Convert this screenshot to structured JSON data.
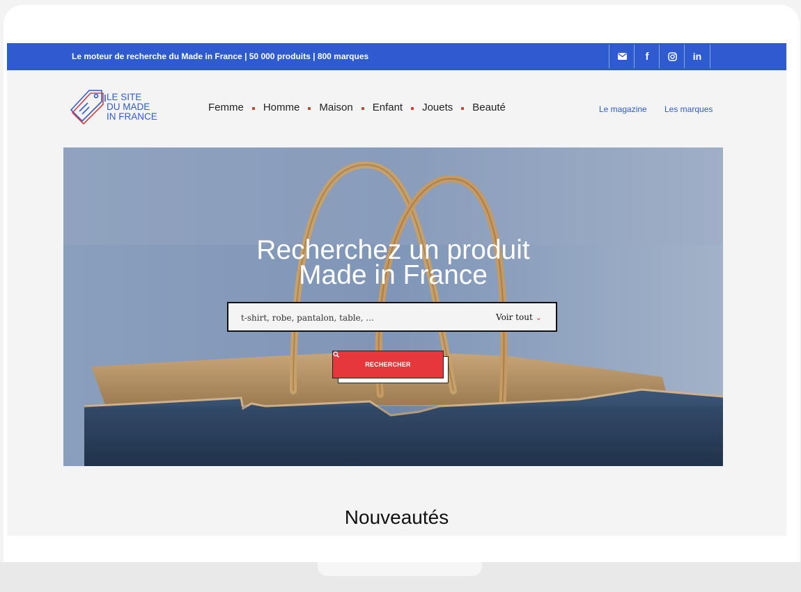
{
  "topbar": {
    "tagline": "Le moteur de recherche du Made in France | 50 000 produits | 800 marques",
    "social": [
      "email-icon",
      "facebook-icon",
      "instagram-icon",
      "linkedin-icon"
    ],
    "social_glyphs": {
      "facebook": "f",
      "linkedin": "in"
    }
  },
  "logo": {
    "text": "LE SITE\nDU MADE\nIN FRANCE"
  },
  "nav": {
    "items": [
      "Femme",
      "Homme",
      "Maison",
      "Enfant",
      "Jouets",
      "Beauté"
    ],
    "secondary": [
      "Le magazine",
      "Les marques"
    ]
  },
  "hero": {
    "title_line1": "Recherchez un produit",
    "title_line2": "Made in France",
    "search_placeholder": "t-shirt, robe, pantalon, table, ...",
    "see_all": "Voir tout",
    "search_button": "RECHERCHER"
  },
  "sections": {
    "new_title": "Nouveautés"
  },
  "colors": {
    "brand_blue": "#2f5bd0",
    "accent_red": "#e5373c"
  }
}
